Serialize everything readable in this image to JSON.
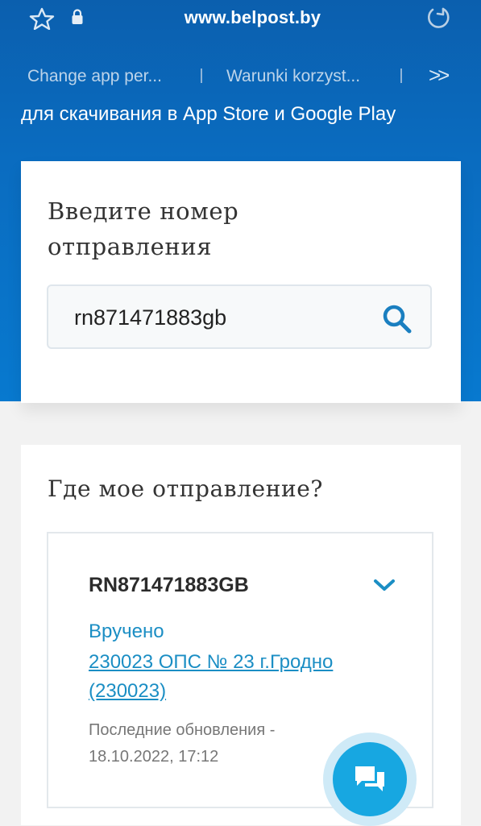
{
  "browser": {
    "url": "www.belpost.by",
    "icons": [
      "star-icon",
      "lock-icon",
      "reload-icon"
    ]
  },
  "nav": {
    "items": [
      "Change app per...",
      "Warunki korzyst..."
    ],
    "more": ">>"
  },
  "promo_text": "для скачивания в App Store и Google Play",
  "search": {
    "label": "Введите номер отправления",
    "value": "rn871471883gb"
  },
  "result": {
    "heading": "Где мое отправление?",
    "tracking_number": "RN871471883GB",
    "status": "Вручено",
    "office": "230023 ОПС № 23 г.Гродно (230023)",
    "updated_label": "Последние обновления - 18.10.2022, 17:12"
  },
  "colors": {
    "header_blue": "#0a6cc0",
    "accent": "#1b8ec4",
    "chat": "#17a7e1"
  }
}
